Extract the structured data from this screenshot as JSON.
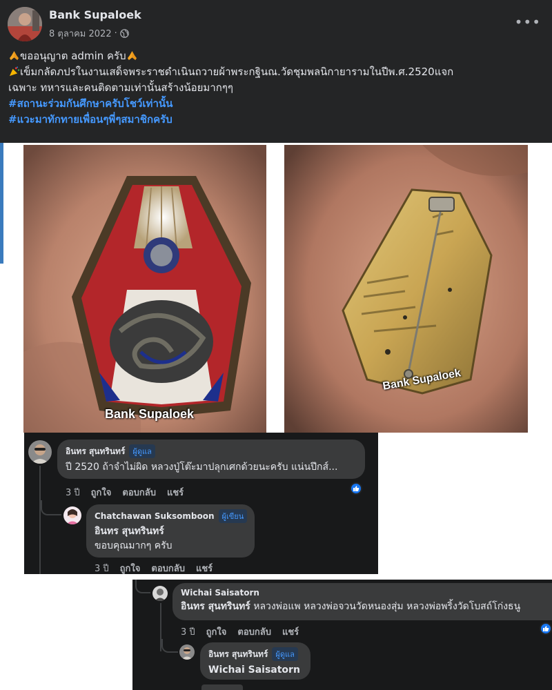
{
  "post": {
    "author": "Bank Supaloek",
    "date": "8 ตุลาคม 2022",
    "separator": "·",
    "more": "•••",
    "line1": "ขออนุญาต admin ครับ",
    "line2": "เข็มกลัดภปรในงานเสด็จพระราชดำเนินถวายผ้าพระกฐินณ.วัดชุมพลนิกายารามในปีพ.ศ.2520แจก",
    "line3": "เฉพาะ ทหารและคนติดตามเท่านั้นสร้างน้อยมากๆๆ",
    "hashtag1": "#สถานะร่วมกันศึกษาครับโชว์เท่านั้น",
    "hashtag2": "#แวะมาทักทายเพื่อนๆพี่ๆสมาชิกครับ",
    "icons": [
      "globe-icon",
      "praying-hands-icon",
      "party-popper-icon",
      "more-icon"
    ]
  },
  "photos": {
    "watermark_front": "Bank Supaloek",
    "watermark_back": "Bank Supaloek"
  },
  "comments": [
    {
      "author": "อินทร สุนทรินทร์",
      "badge": "ผู้ดูแล",
      "text": "ปี 2520 ถ้าจำไม่ผิด หลวงปู่โต๊ะมาปลุกเศกด้วยนะครับ แน่นปึกส์...",
      "age": "3 ปี",
      "like": "ถูกใจ",
      "reply": "ตอบกลับ",
      "share": "แชร์",
      "reaction": "like-icon"
    },
    {
      "author": "Chatchawan Suksomboon",
      "badge": "ผู้เขียน",
      "mention": "อินทร สุนทรินทร์",
      "text": "ขอบคุณมากๆ ครับ",
      "age": "3 ปี",
      "like": "ถูกใจ",
      "reply": "ตอบกลับ",
      "share": "แชร์"
    },
    {
      "author": "Wichai Saisatorn",
      "mention": "อินทร สุนทรินทร์",
      "text": " หลวงพ่อแพ หลวงพ่อจวนวัดหนองสุ่ม หลวงพ่อพริ้งวัดโบสถ์โก่งธนู",
      "age": "3 ปี",
      "like": "ถูกใจ",
      "reply": "ตอบกลับ",
      "share": "แชร์",
      "reaction": "like-icon"
    },
    {
      "author": "อินทร สุนทรินทร์",
      "badge": "ผู้ดูแล",
      "mention": "Wichai Saisatorn"
    }
  ],
  "colors": {
    "post_bg": "#242526",
    "comment_bg": "#18191a",
    "bubble_bg": "#3a3b3c",
    "link": "#4599ff",
    "text": "#e4e6eb",
    "muted": "#b0b3b8"
  }
}
